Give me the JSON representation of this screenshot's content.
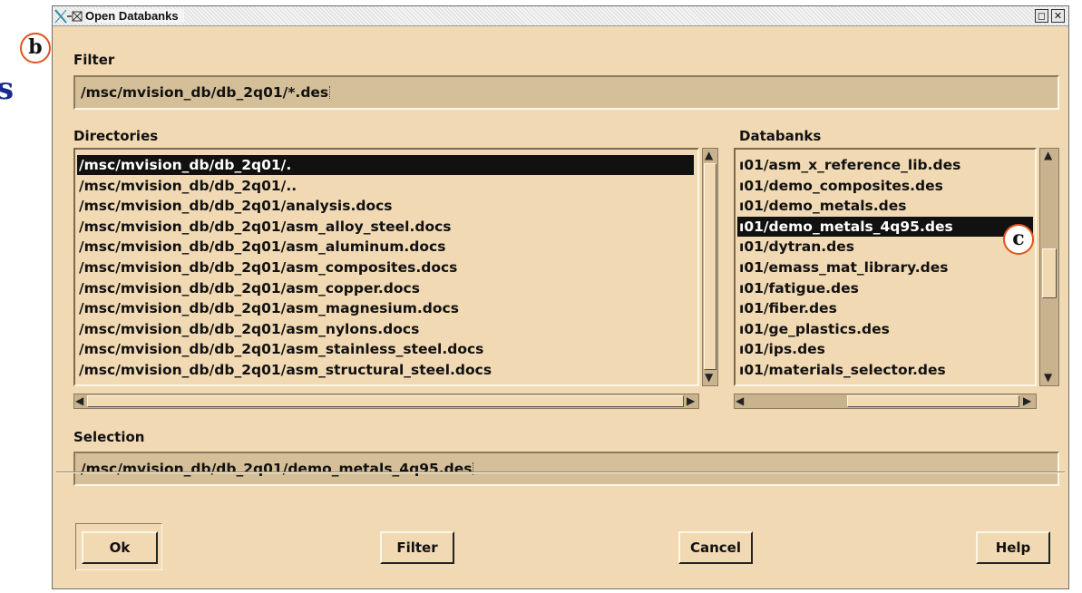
{
  "side_letter": "s",
  "window": {
    "title": "Open Databanks",
    "buttons": [
      "◻",
      "✕"
    ]
  },
  "callouts": {
    "b": "b",
    "c": "c"
  },
  "filter": {
    "label": "Filter",
    "value": "/msc/mvision_db/db_2q01/*.des"
  },
  "directories": {
    "label": "Directories",
    "selected_index": 0,
    "items": [
      "/msc/mvision_db/db_2q01/.",
      "/msc/mvision_db/db_2q01/..",
      "/msc/mvision_db/db_2q01/analysis.docs",
      "/msc/mvision_db/db_2q01/asm_alloy_steel.docs",
      "/msc/mvision_db/db_2q01/asm_aluminum.docs",
      "/msc/mvision_db/db_2q01/asm_composites.docs",
      "/msc/mvision_db/db_2q01/asm_copper.docs",
      "/msc/mvision_db/db_2q01/asm_magnesium.docs",
      "/msc/mvision_db/db_2q01/asm_nylons.docs",
      "/msc/mvision_db/db_2q01/asm_stainless_steel.docs",
      "/msc/mvision_db/db_2q01/asm_structural_steel.docs"
    ]
  },
  "databanks": {
    "label": "Databanks",
    "selected_index": 3,
    "items": [
      "ı01/asm_x_reference_lib.des",
      "ı01/demo_composites.des",
      "ı01/demo_metals.des",
      "ı01/demo_metals_4q95.des",
      "ı01/dytran.des",
      "ı01/emass_mat_library.des",
      "ı01/fatigue.des",
      "ı01/fiber.des",
      "ı01/ge_plastics.des",
      "ı01/ips.des",
      "ı01/materials_selector.des"
    ]
  },
  "selection": {
    "label": "Selection",
    "value": "/msc/mvision_db/db_2q01/demo_metals_4q95.des"
  },
  "actions": {
    "ok": "Ok",
    "filter": "Filter",
    "cancel": "Cancel",
    "help": "Help"
  },
  "colors": {
    "dialog_bg": "#f1d9b3",
    "field_bg": "#d5bf98",
    "selected_row": "#111111",
    "callout_ring": "#e0521c",
    "side_letter": "#1a2a8c"
  }
}
